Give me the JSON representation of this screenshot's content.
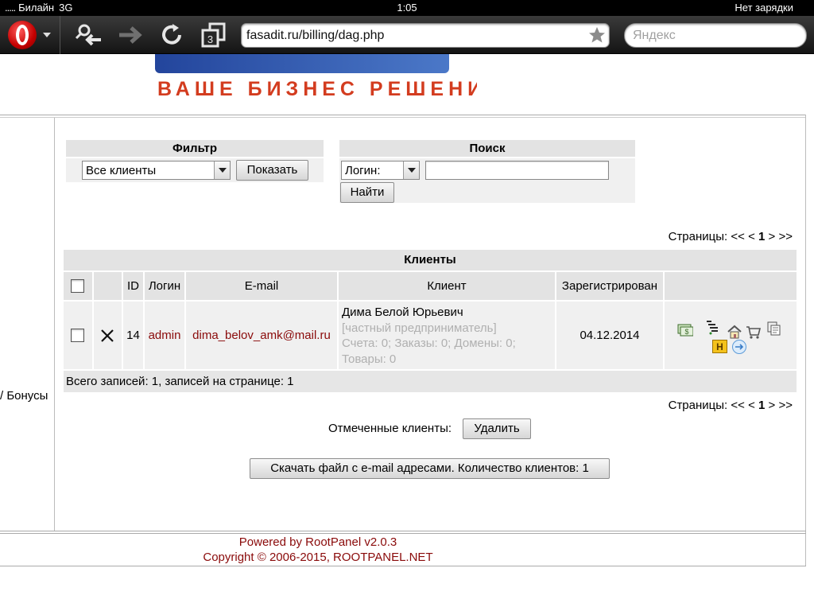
{
  "status_bar": {
    "carrier": "Билайн",
    "network": "3G",
    "time": "1:05",
    "battery": "Нет зарядки"
  },
  "browser": {
    "tab_count": "3",
    "url": "fasadit.ru/billing/dag.php",
    "search_placeholder": "Яндекс"
  },
  "logo": {
    "tagline": "ВАШЕ БИЗНЕС РЕШЕНИЕ"
  },
  "sidebar": {
    "visible_link": "/ Бонусы"
  },
  "filter": {
    "title": "Фильтр",
    "selected": "Все клиенты",
    "show_button": "Показать"
  },
  "search": {
    "title": "Поиск",
    "field_selected": "Логин:",
    "query": "",
    "find_button": "Найти"
  },
  "pagination": {
    "label": "Страницы:",
    "first": "<<",
    "prev": "<",
    "current": "1",
    "next": ">",
    "last": ">>"
  },
  "clients_table": {
    "title": "Клиенты",
    "columns": [
      "ID",
      "Логин",
      "E-mail",
      "Клиент",
      "Зарегистрирован"
    ],
    "rows": [
      {
        "id": "14",
        "login": "admin",
        "email": "dima_belov_amk@mail.ru",
        "client_name": "Дима Белой Юрьевич",
        "client_type": "[частный предприниматель]",
        "client_stats_1": "Счета: 0; Заказы: 0; Домены: 0;",
        "client_stats_2": "Товары: 0",
        "registered": "04.12.2014"
      }
    ],
    "total": "Всего записей: 1, записей на странице: 1"
  },
  "bulk_actions": {
    "label": "Отмеченные клиенты:",
    "delete_button": "Удалить",
    "download_button": "Скачать файл с e-mail адресами. Количество клиентов: 1"
  },
  "footer": {
    "powered_by": "Powered by RootPanel v2.0.3",
    "copyright": "Copyright © 2006-2015, ROOTPANEL.NET"
  },
  "colors": {
    "link_red": "#8a0a0a",
    "panel_header": "#e3e3e3",
    "panel_body": "#f0f0f0",
    "toolbar": "#1e1e1e"
  },
  "icons": [
    "back-icon",
    "forward-icon",
    "reload-icon",
    "tabs-icon",
    "star-icon",
    "delete-x-icon",
    "billing-icon",
    "tariff-icon",
    "home-icon",
    "cart-icon",
    "copy-icon",
    "hosting-icon",
    "login-as-icon"
  ]
}
